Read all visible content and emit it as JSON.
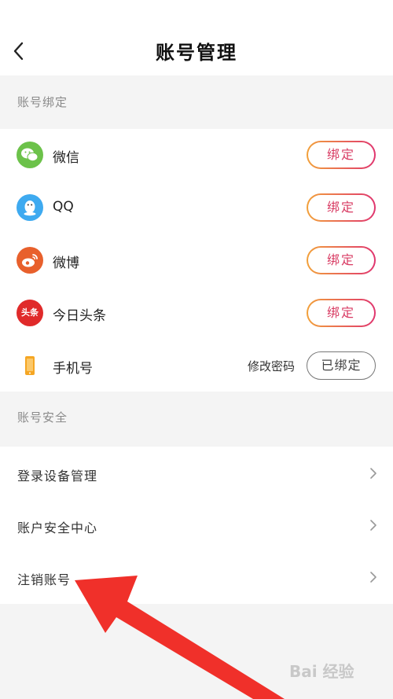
{
  "header": {
    "title": "账号管理"
  },
  "binding_section": {
    "title": "账号绑定",
    "items": [
      {
        "label": "微信",
        "action": "绑定",
        "icon": "wechat-icon",
        "color": "#6cc24a"
      },
      {
        "label": "QQ",
        "action": "绑定",
        "icon": "qq-icon",
        "color": "#3eaaf0"
      },
      {
        "label": "微博",
        "action": "绑定",
        "icon": "weibo-icon",
        "color": "#e8602c"
      },
      {
        "label": "今日头条",
        "action": "绑定",
        "icon": "toutiao-icon",
        "color": "#e02a2a",
        "icon_text": "头条"
      },
      {
        "label": "手机号",
        "action": "已绑定",
        "icon": "phone-icon",
        "color": "#f5a623",
        "secondary": "修改密码"
      }
    ]
  },
  "security_section": {
    "title": "账号安全",
    "items": [
      {
        "label": "登录设备管理"
      },
      {
        "label": "账户安全中心"
      },
      {
        "label": "注销账号"
      }
    ]
  },
  "colors": {
    "accent_start": "#f2a13a",
    "accent_end": "#e0356f",
    "arrow": "#f0302a"
  },
  "watermark": {
    "text": "Bai 经验"
  }
}
